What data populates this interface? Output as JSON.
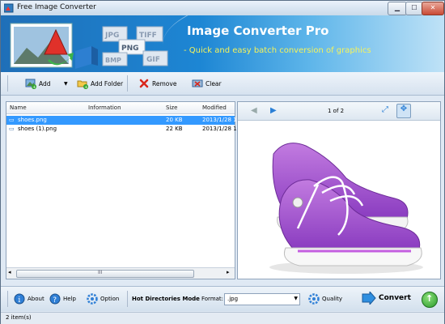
{
  "window": {
    "title": "Free Image Converter"
  },
  "banner": {
    "title": "Image Converter Pro",
    "subtitle": "- Quick and easy batch conversion of graphics",
    "format_badges": [
      "JPG",
      "TIFF",
      "PNG",
      "BMP",
      "GIF"
    ]
  },
  "toolbar": {
    "add_label": "Add",
    "add_folder_label": "Add Folder",
    "remove_label": "Remove",
    "clear_label": "Clear"
  },
  "file_list": {
    "columns": [
      "Name",
      "Information",
      "Size",
      "Modified"
    ],
    "rows": [
      {
        "name": "shoes.png",
        "information": "",
        "size": "20 KB",
        "modified": "2013/1/28 1!",
        "selected": true
      },
      {
        "name": "shoes (1).png",
        "information": "",
        "size": "22 KB",
        "modified": "2013/1/28 1!",
        "selected": false
      }
    ],
    "scroll_marker": "III"
  },
  "preview": {
    "page_indicator": "1 of 2"
  },
  "bottom": {
    "about_label": "About",
    "help_label": "Help",
    "option_label": "Option",
    "hot_dirs_label": "Hot Directories Mode",
    "format_label": "Format:",
    "format_value": ".jpg",
    "quality_label": "Quality",
    "convert_label": "Convert"
  },
  "status": {
    "items": "2 item(s)"
  },
  "colors": {
    "accent": "#1d86d4",
    "selection": "#3399ff",
    "subtitle": "#f6f35a"
  }
}
